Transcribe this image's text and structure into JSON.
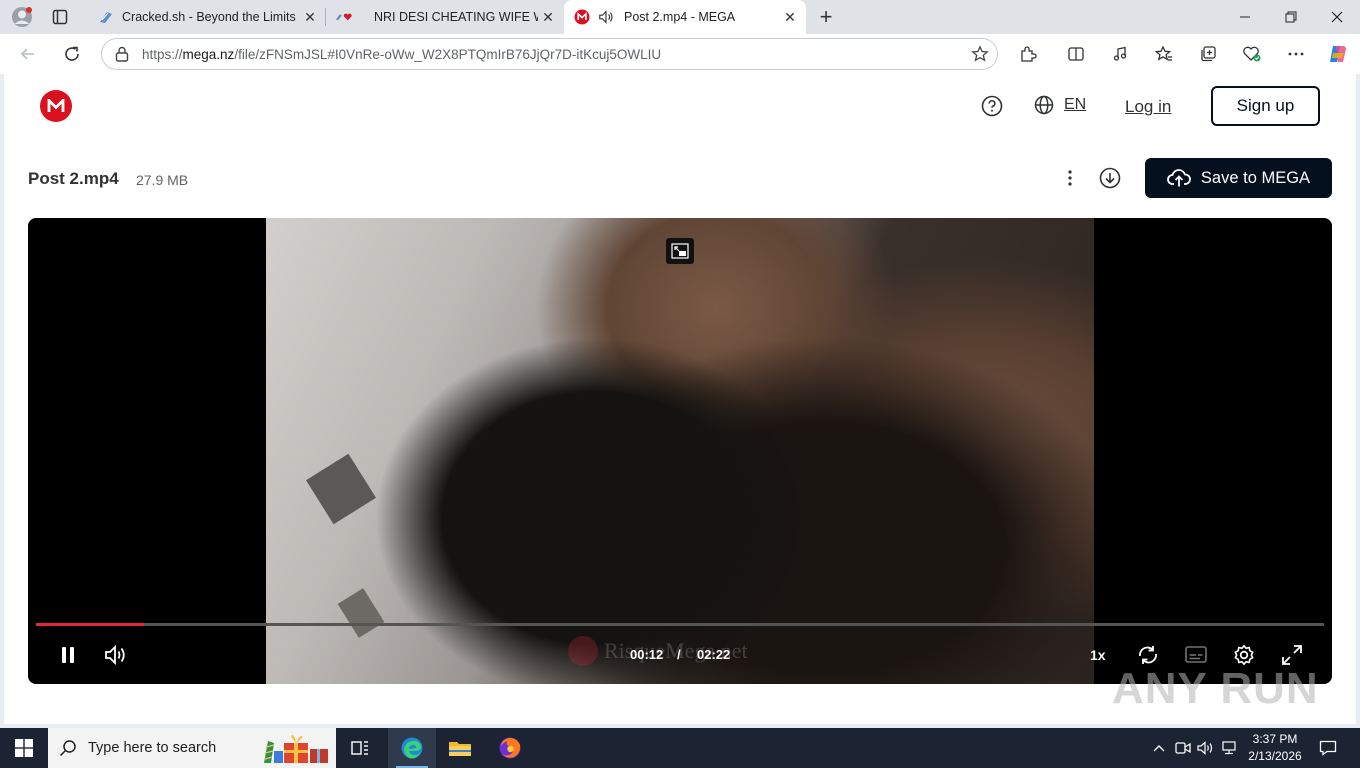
{
  "browser": {
    "tabs": [
      {
        "title": "Cracked.sh - Beyond the Limits",
        "icon": "cracked-favicon",
        "active": false
      },
      {
        "title": "NRI DESI CHEATING WIFE WIT",
        "icon": "heart-favicon",
        "active": false
      },
      {
        "title": "Post 2.mp4 - MEGA",
        "icon": "mega-favicon",
        "active": true,
        "audio": true
      }
    ],
    "new_tab_label": "+",
    "url_prefix": "https://",
    "url_host": "mega.nz",
    "url_path": "/file/zFNSmJSL#I0VnRe-oWw_W2X8PTQmIrB76JjQr7D-itKcuj5OWLIU"
  },
  "header": {
    "lang": "EN",
    "login": "Log in",
    "signup": "Sign up"
  },
  "file": {
    "name": "Post 2.mp4",
    "size": "27.9 MB",
    "save_label": "Save to MEGA"
  },
  "player": {
    "current_time": "00:12",
    "separator": "/",
    "duration": "02:22",
    "progress_fraction": 0.084,
    "speed": "1x",
    "watermark": "RisqueMega.net"
  },
  "watermark_overlay": "ANY RUN",
  "taskbar": {
    "search_placeholder": "Type here to search",
    "time": "3:37 PM",
    "date": "2/13/2026"
  },
  "colors": {
    "mega_red": "#d9101f",
    "mega_dark": "#04101e",
    "progress_red": "#e0283a",
    "taskbar": "#1c2433"
  }
}
